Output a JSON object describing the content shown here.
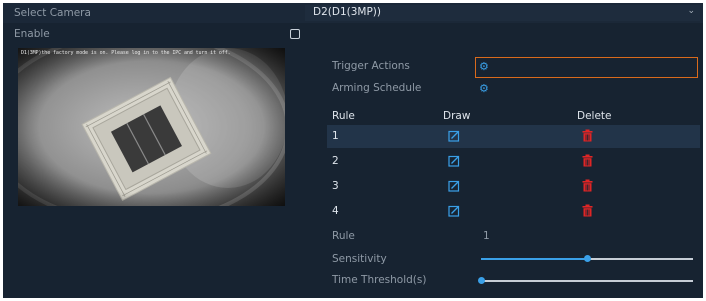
{
  "form": {
    "select_camera_label": "Select Camera",
    "select_camera_value": "D2(D1(3MP))",
    "enable_label": "Enable",
    "enable_checked": false
  },
  "preview": {
    "osd_text": "D1(3MP)the factory mode is on. Please log in to the IPC and turn it off."
  },
  "actions": {
    "trigger_label": "Trigger Actions",
    "arming_label": "Arming Schedule",
    "icon": "gear-icon"
  },
  "rules_table": {
    "headers": {
      "rule": "Rule",
      "draw": "Draw",
      "delete": "Delete"
    },
    "rows": [
      {
        "rule": "1"
      },
      {
        "rule": "2"
      },
      {
        "rule": "3"
      },
      {
        "rule": "4"
      }
    ],
    "selected_index": 0
  },
  "settings": {
    "rule_label": "Rule",
    "rule_value": "1",
    "sensitivity_label": "Sensitivity",
    "sensitivity_level": 0.5,
    "threshold_label": "Time Threshold(s)",
    "threshold_level": 0.0
  },
  "colors": {
    "background": "#172331",
    "accent": "#3aa0e8",
    "focus_border": "#d96a1c",
    "delete_red": "#e02525"
  }
}
